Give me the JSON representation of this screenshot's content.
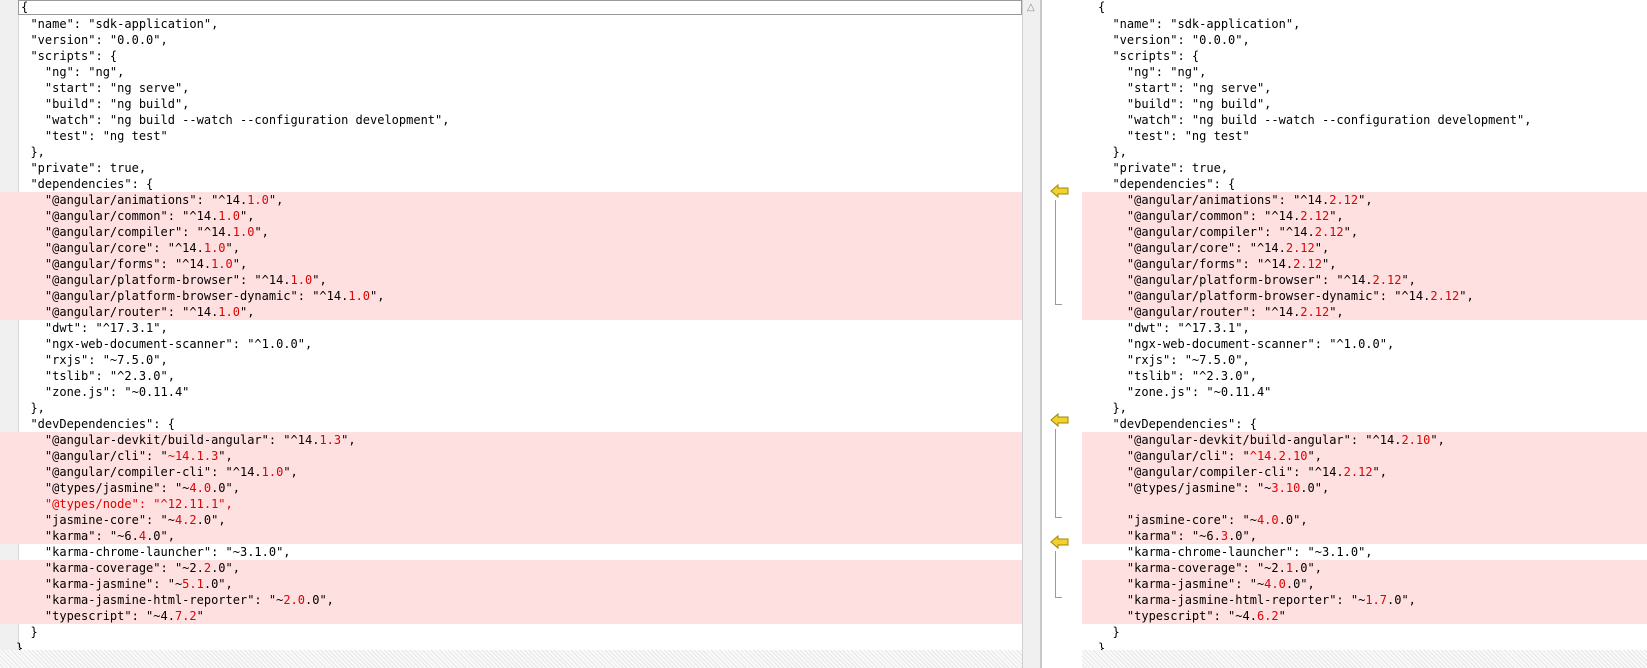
{
  "left": {
    "first_line": "{",
    "lines": [
      {
        "text": "  \"name\": \"sdk-application\",",
        "diff": false
      },
      {
        "text": "  \"version\": \"0.0.0\",",
        "diff": false
      },
      {
        "text": "  \"scripts\": {",
        "diff": false
      },
      {
        "text": "    \"ng\": \"ng\",",
        "diff": false
      },
      {
        "text": "    \"start\": \"ng serve\",",
        "diff": false
      },
      {
        "text": "    \"build\": \"ng build\",",
        "diff": false
      },
      {
        "text": "    \"watch\": \"ng build --watch --configuration development\",",
        "diff": false
      },
      {
        "text": "    \"test\": \"ng test\"",
        "diff": false
      },
      {
        "text": "  },",
        "diff": false
      },
      {
        "text": "  \"private\": true,",
        "diff": false
      },
      {
        "text": "  \"dependencies\": {",
        "diff": false
      },
      {
        "parts": [
          "    \"@angular/animations\": \"^14.",
          {
            "c": "1.0"
          },
          "\","
        ],
        "diff": true
      },
      {
        "parts": [
          "    \"@angular/common\": \"^14.",
          {
            "c": "1.0"
          },
          "\","
        ],
        "diff": true
      },
      {
        "parts": [
          "    \"@angular/compiler\": \"^14.",
          {
            "c": "1.0"
          },
          "\","
        ],
        "diff": true
      },
      {
        "parts": [
          "    \"@angular/core\": \"^14.",
          {
            "c": "1.0"
          },
          "\","
        ],
        "diff": true
      },
      {
        "parts": [
          "    \"@angular/forms\": \"^14.",
          {
            "c": "1.0"
          },
          "\","
        ],
        "diff": true
      },
      {
        "parts": [
          "    \"@angular/platform-browser\": \"^14.",
          {
            "c": "1.0"
          },
          "\","
        ],
        "diff": true
      },
      {
        "parts": [
          "    \"@angular/platform-browser-dynamic\": \"^14.",
          {
            "c": "1.0"
          },
          "\","
        ],
        "diff": true
      },
      {
        "parts": [
          "    \"@angular/router\": \"^14.",
          {
            "c": "1.0"
          },
          "\","
        ],
        "diff": true
      },
      {
        "text": "    \"dwt\": \"^17.3.1\",",
        "diff": false
      },
      {
        "text": "    \"ngx-web-document-scanner\": \"^1.0.0\",",
        "diff": false
      },
      {
        "text": "    \"rxjs\": \"~7.5.0\",",
        "diff": false
      },
      {
        "text": "    \"tslib\": \"^2.3.0\",",
        "diff": false
      },
      {
        "text": "    \"zone.js\": \"~0.11.4\"",
        "diff": false
      },
      {
        "text": "  },",
        "diff": false
      },
      {
        "text": "  \"devDependencies\": {",
        "diff": false
      },
      {
        "parts": [
          "    \"@angular-devkit/build-angular\": \"^14.",
          {
            "c": "1.3"
          },
          "\","
        ],
        "diff": true
      },
      {
        "parts": [
          "    \"@angular/cli\": \"",
          {
            "c": "~14.1.3"
          },
          "\","
        ],
        "diff": true
      },
      {
        "parts": [
          "    \"@angular/compiler-cli\": \"^14.",
          {
            "c": "1.0"
          },
          "\","
        ],
        "diff": true
      },
      {
        "parts": [
          "    \"@types/jasmine\": \"~",
          {
            "c": "4.0"
          },
          ".0\","
        ],
        "diff": true
      },
      {
        "parts": [
          "    ",
          {
            "c": "\"@types/node\": \"^12.11.1\","
          }
        ],
        "diff": true
      },
      {
        "parts": [
          "    \"jasmine-core\": \"~",
          {
            "c": "4.2"
          },
          ".0\","
        ],
        "diff": true
      },
      {
        "parts": [
          "    \"karma\": \"~6.",
          {
            "c": "4"
          },
          ".0\","
        ],
        "diff": true
      },
      {
        "text": "    \"karma-chrome-launcher\": \"~3.1.0\",",
        "diff": false
      },
      {
        "parts": [
          "    \"karma-coverage\": \"~2.",
          {
            "c": "2"
          },
          ".0\","
        ],
        "diff": true
      },
      {
        "parts": [
          "    \"karma-jasmine\": \"~",
          {
            "c": "5.1"
          },
          ".0\","
        ],
        "diff": true
      },
      {
        "parts": [
          "    \"karma-jasmine-html-reporter\": \"~",
          {
            "c": "2.0"
          },
          ".0\","
        ],
        "diff": true
      },
      {
        "parts": [
          "    \"typescript\": \"~4.",
          {
            "c": "7.2"
          },
          "\""
        ],
        "diff": true
      },
      {
        "text": "  }",
        "diff": false
      },
      {
        "text": "}",
        "diff": false
      }
    ]
  },
  "right": {
    "first_line": "{",
    "lines": [
      {
        "text": "  \"name\": \"sdk-application\",",
        "diff": false
      },
      {
        "text": "  \"version\": \"0.0.0\",",
        "diff": false
      },
      {
        "text": "  \"scripts\": {",
        "diff": false
      },
      {
        "text": "    \"ng\": \"ng\",",
        "diff": false
      },
      {
        "text": "    \"start\": \"ng serve\",",
        "diff": false
      },
      {
        "text": "    \"build\": \"ng build\",",
        "diff": false
      },
      {
        "text": "    \"watch\": \"ng build --watch --configuration development\",",
        "diff": false
      },
      {
        "text": "    \"test\": \"ng test\"",
        "diff": false
      },
      {
        "text": "  },",
        "diff": false
      },
      {
        "text": "  \"private\": true,",
        "diff": false
      },
      {
        "text": "  \"dependencies\": {",
        "diff": false
      },
      {
        "parts": [
          "    \"@angular/animations\": \"^14.",
          {
            "c": "2.12"
          },
          "\","
        ],
        "diff": true
      },
      {
        "parts": [
          "    \"@angular/common\": \"^14.",
          {
            "c": "2.12"
          },
          "\","
        ],
        "diff": true
      },
      {
        "parts": [
          "    \"@angular/compiler\": \"^14.",
          {
            "c": "2.12"
          },
          "\","
        ],
        "diff": true
      },
      {
        "parts": [
          "    \"@angular/core\": \"^14.",
          {
            "c": "2.12"
          },
          "\","
        ],
        "diff": true
      },
      {
        "parts": [
          "    \"@angular/forms\": \"^14.",
          {
            "c": "2.12"
          },
          "\","
        ],
        "diff": true
      },
      {
        "parts": [
          "    \"@angular/platform-browser\": \"^14.",
          {
            "c": "2.12"
          },
          "\","
        ],
        "diff": true
      },
      {
        "parts": [
          "    \"@angular/platform-browser-dynamic\": \"^14.",
          {
            "c": "2.12"
          },
          "\","
        ],
        "diff": true
      },
      {
        "parts": [
          "    \"@angular/router\": \"^14.",
          {
            "c": "2.12"
          },
          "\","
        ],
        "diff": true
      },
      {
        "text": "    \"dwt\": \"^17.3.1\",",
        "diff": false
      },
      {
        "text": "    \"ngx-web-document-scanner\": \"^1.0.0\",",
        "diff": false
      },
      {
        "text": "    \"rxjs\": \"~7.5.0\",",
        "diff": false
      },
      {
        "text": "    \"tslib\": \"^2.3.0\",",
        "diff": false
      },
      {
        "text": "    \"zone.js\": \"~0.11.4\"",
        "diff": false
      },
      {
        "text": "  },",
        "diff": false
      },
      {
        "text": "  \"devDependencies\": {",
        "diff": false
      },
      {
        "parts": [
          "    \"@angular-devkit/build-angular\": \"^14.",
          {
            "c": "2.10"
          },
          "\","
        ],
        "diff": true
      },
      {
        "parts": [
          "    \"@angular/cli\": \"",
          {
            "c": "^14.2.10"
          },
          "\","
        ],
        "diff": true
      },
      {
        "parts": [
          "    \"@angular/compiler-cli\": \"^14.",
          {
            "c": "2.12"
          },
          "\","
        ],
        "diff": true
      },
      {
        "parts": [
          "    \"@types/jasmine\": \"~",
          {
            "c": "3.10"
          },
          ".0\","
        ],
        "diff": true
      },
      {
        "text": "",
        "diff": true
      },
      {
        "parts": [
          "    \"jasmine-core\": \"~",
          {
            "c": "4.0"
          },
          ".0\","
        ],
        "diff": true
      },
      {
        "parts": [
          "    \"karma\": \"~6.",
          {
            "c": "3"
          },
          ".0\","
        ],
        "diff": true
      },
      {
        "text": "    \"karma-chrome-launcher\": \"~3.1.0\",",
        "diff": false
      },
      {
        "parts": [
          "    \"karma-coverage\": \"~2.",
          {
            "c": "1"
          },
          ".0\","
        ],
        "diff": true
      },
      {
        "parts": [
          "    \"karma-jasmine\": \"~",
          {
            "c": "4.0"
          },
          ".0\","
        ],
        "diff": true
      },
      {
        "parts": [
          "    \"karma-jasmine-html-reporter\": \"~",
          {
            "c": "1.7"
          },
          ".0\","
        ],
        "diff": true
      },
      {
        "parts": [
          "    \"typescript\": \"~4.",
          {
            "c": "6.2"
          },
          "\""
        ],
        "diff": true
      },
      {
        "text": "  }",
        "diff": false
      },
      {
        "text": "}",
        "diff": false
      }
    ]
  },
  "markers": [
    {
      "icon": "copy-left-arrow-icon",
      "block": "dependencies"
    },
    {
      "icon": "copy-left-arrow-icon",
      "block": "devDependencies-1"
    },
    {
      "icon": "copy-left-arrow-icon",
      "block": "devDependencies-2"
    }
  ],
  "colors": {
    "diff_bg": "#ffe0e0",
    "changed_text": "#e00000",
    "arrow": "#e8c400"
  }
}
